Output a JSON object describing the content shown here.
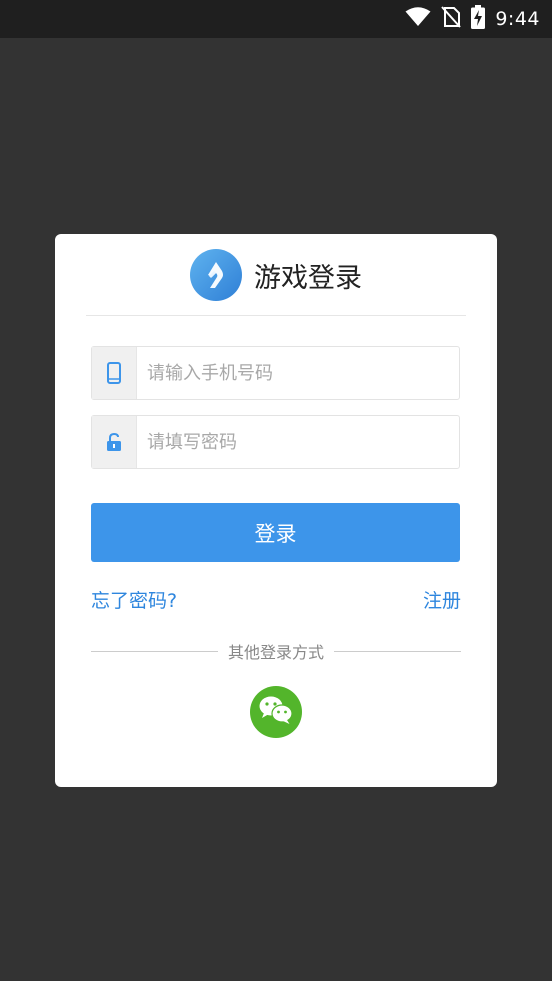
{
  "status_bar": {
    "time": "9:44",
    "icons": [
      "wifi-icon",
      "no-sim-icon",
      "battery-charging-icon"
    ]
  },
  "login_card": {
    "title": "游戏登录",
    "logo_icon": "game-logo-icon",
    "phone_field": {
      "placeholder": "请输入手机号码",
      "value": "",
      "icon": "phone-icon"
    },
    "password_field": {
      "placeholder": "请填写密码",
      "value": "",
      "icon": "lock-icon"
    },
    "login_button_label": "登录",
    "forgot_password_label": "忘了密码?",
    "register_label": "注册",
    "other_login_label": "其他登录方式",
    "wechat_icon": "wechat-icon"
  },
  "colors": {
    "accent": "#3d95ea",
    "link": "#2e86de",
    "wechat": "#53b52b",
    "backdrop": "#333333"
  }
}
